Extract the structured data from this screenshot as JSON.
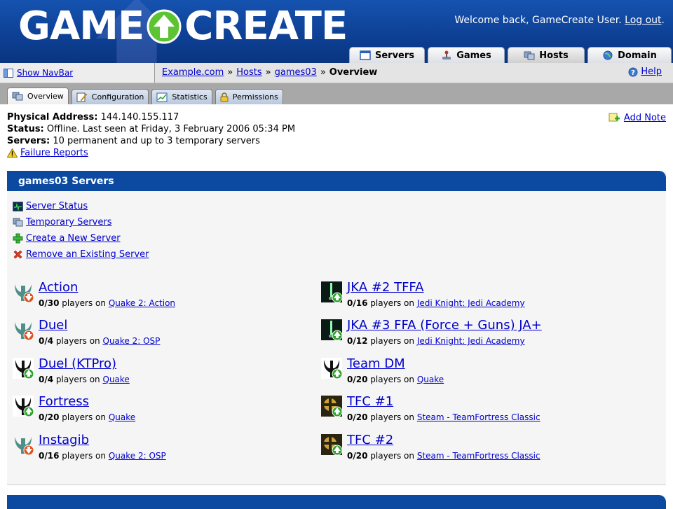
{
  "header": {
    "logo_left": "GAME",
    "logo_right": "CREATE",
    "welcome_text": "Welcome back, GameCreate User.",
    "logout_label": "Log out",
    "welcome_suffix": ".",
    "tabs": [
      {
        "label": "Servers",
        "icon": "servers-icon"
      },
      {
        "label": "Games",
        "icon": "joystick-icon"
      },
      {
        "label": "Hosts",
        "icon": "hosts-icon",
        "active": true
      },
      {
        "label": "Domain",
        "icon": "globe-icon"
      }
    ]
  },
  "navbar": {
    "show_navbar_label": "Show NavBar",
    "breadcrumb": [
      "Example.com",
      "Hosts",
      "games03"
    ],
    "breadcrumb_separator": "»",
    "breadcrumb_current": "Overview",
    "help_label": "Help"
  },
  "subtabs": [
    {
      "label": "Overview",
      "icon": "hosts-icon",
      "active": true
    },
    {
      "label": "Configuration",
      "icon": "edit-icon"
    },
    {
      "label": "Statistics",
      "icon": "chart-icon"
    },
    {
      "label": "Permissions",
      "icon": "lock-icon"
    }
  ],
  "host": {
    "address_label": "Physical Address:",
    "address_value": "144.140.155.117",
    "status_label": "Status:",
    "status_value": "Offline. Last seen at Friday, 3 February 2006 05:34 PM",
    "servers_label": "Servers:",
    "servers_value": "10 permanent and up to 3 temporary servers",
    "failure_reports_label": "Failure Reports",
    "add_note_label": "Add Note"
  },
  "panel": {
    "title": "games03 Servers",
    "actions": [
      {
        "label": "Server Status",
        "icon": "monitor-icon"
      },
      {
        "label": "Temporary Servers",
        "icon": "servers-icon"
      },
      {
        "label": "Create a New Server",
        "icon": "add-icon"
      },
      {
        "label": "Remove an Existing Server",
        "icon": "remove-icon"
      }
    ],
    "players_suffix": "players on",
    "servers_left": [
      {
        "name": "Action",
        "players": "0/30",
        "game": "Quake 2: Action",
        "icon": "quake2-icon",
        "status": "down"
      },
      {
        "name": "Duel",
        "players": "0/4",
        "game": "Quake 2: OSP",
        "icon": "quake2-icon",
        "status": "down"
      },
      {
        "name": "Duel (KTPro)",
        "players": "0/4",
        "game": "Quake",
        "icon": "quake-icon",
        "status": "up"
      },
      {
        "name": "Fortress",
        "players": "0/20",
        "game": "Quake",
        "icon": "quake-icon",
        "status": "up"
      },
      {
        "name": "Instagib",
        "players": "0/16",
        "game": "Quake 2: OSP",
        "icon": "quake2-icon",
        "status": "down"
      }
    ],
    "servers_right": [
      {
        "name": "JKA #2 TFFA",
        "players": "0/16",
        "game": "Jedi Knight: Jedi Academy",
        "icon": "jka-icon",
        "status": "up"
      },
      {
        "name": "JKA #3 FFA (Force + Guns) JA+",
        "players": "0/12",
        "game": "Jedi Knight: Jedi Academy",
        "icon": "jka-icon",
        "status": "up"
      },
      {
        "name": "Team DM",
        "players": "0/20",
        "game": "Quake",
        "icon": "quake-icon",
        "status": "up"
      },
      {
        "name": "TFC #1",
        "players": "0/20",
        "game": "Steam - TeamFortress Classic",
        "icon": "tfc-icon",
        "status": "up"
      },
      {
        "name": "TFC #2",
        "players": "0/20",
        "game": "Steam - TeamFortress Classic",
        "icon": "tfc-icon",
        "status": "up"
      }
    ]
  },
  "colors": {
    "header_blue": "#0d3f93",
    "panel_blue": "#0b4aa0",
    "link": "#0000cc",
    "status_up": "#2aa52a",
    "status_down": "#e0501e"
  }
}
